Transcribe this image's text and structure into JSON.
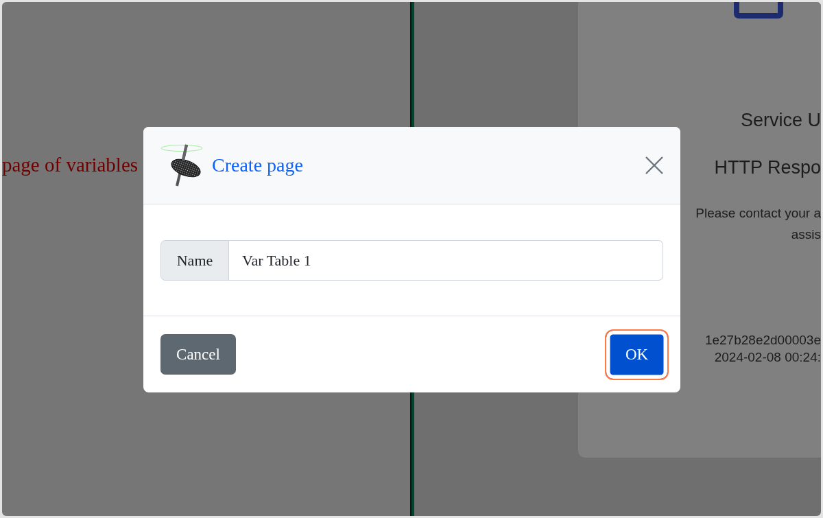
{
  "left_page": {
    "caption": "page of variables"
  },
  "error_card": {
    "title": "Service U",
    "status": "HTTP Respo",
    "message": [
      "Please contact your a",
      "assis"
    ],
    "details": [
      "1e27b28e2d00003e",
      "2024-02-08 00:24:"
    ]
  },
  "dialog": {
    "title": "Create page",
    "field": {
      "label": "Name",
      "value": "Var Table 1"
    },
    "buttons": [
      {
        "label": "Cancel",
        "kind": "secondary",
        "focused": false
      },
      {
        "label": "OK",
        "kind": "primary",
        "focused": true
      }
    ]
  }
}
